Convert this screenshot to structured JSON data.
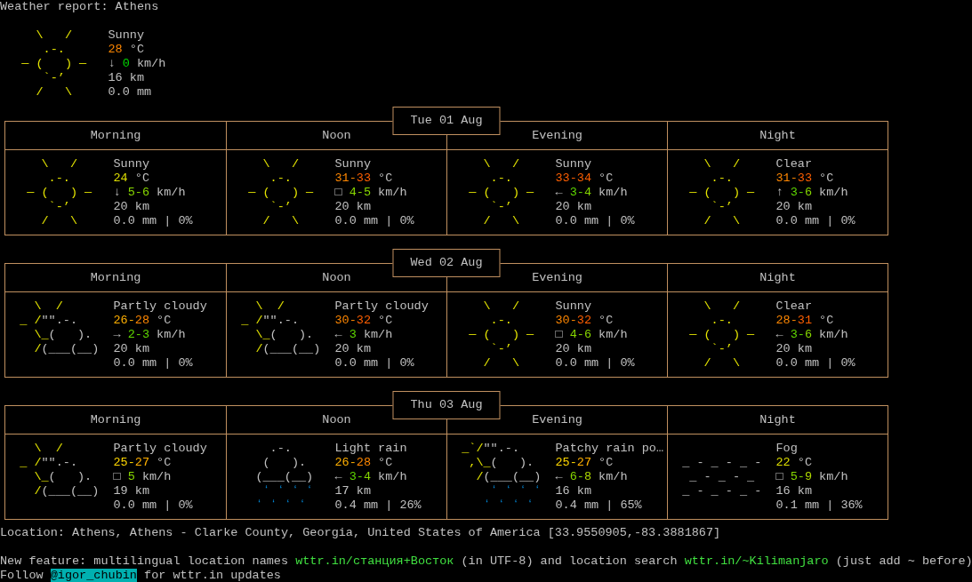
{
  "title": "Weather report: Athens",
  "current": {
    "art": [
      [
        {
          "text": "    \\   /    ",
          "kind": "sun"
        }
      ],
      [
        {
          "text": "     .-.     ",
          "kind": "sun"
        }
      ],
      [
        {
          "text": "  ― (   ) ―  ",
          "kind": "sun"
        }
      ],
      [
        {
          "text": "     `-’     ",
          "kind": "sun"
        }
      ],
      [
        {
          "text": "    /   \\    ",
          "kind": "sun"
        }
      ]
    ],
    "condition": "Sunny",
    "temp": [
      {
        "text": "28",
        "color": "#ff8700"
      }
    ],
    "temp_unit": "°C",
    "wind_dir": "↓",
    "wind": [
      {
        "text": "0",
        "color": "#00d700"
      }
    ],
    "wind_unit": "km/h",
    "visibility": "16 km",
    "precip": "0.0 mm"
  },
  "days": [
    {
      "date": "Tue 01 Aug",
      "periods": [
        {
          "label": "Morning",
          "kind": "sunny",
          "art": [
            [
              {
                "text": "    \\   /    ",
                "kind": "sun"
              }
            ],
            [
              {
                "text": "     .-.     ",
                "kind": "sun"
              }
            ],
            [
              {
                "text": "  ― (   ) ―  ",
                "kind": "sun"
              }
            ],
            [
              {
                "text": "     `-’     ",
                "kind": "sun"
              }
            ],
            [
              {
                "text": "    /   \\    ",
                "kind": "sun"
              }
            ]
          ],
          "condition": "Sunny",
          "temp": [
            {
              "text": "24",
              "color": "#dfdf00"
            }
          ],
          "temp_unit": "°C",
          "wind_dir": "↓",
          "wind": [
            {
              "text": "5-",
              "color": "#87d700"
            },
            {
              "text": "6",
              "color": "#87d700"
            }
          ],
          "wind_unit": "km/h",
          "visibility": "20 km",
          "precip": "0.0 mm | 0%"
        },
        {
          "label": "Noon",
          "kind": "sunny",
          "art": [
            [
              {
                "text": "    \\   /    ",
                "kind": "sun"
              }
            ],
            [
              {
                "text": "     .-.     ",
                "kind": "sun"
              }
            ],
            [
              {
                "text": "  ― (   ) ―  ",
                "kind": "sun"
              }
            ],
            [
              {
                "text": "     `-’     ",
                "kind": "sun"
              }
            ],
            [
              {
                "text": "    /   \\    ",
                "kind": "sun"
              }
            ]
          ],
          "condition": "Sunny",
          "temp": [
            {
              "text": "31-",
              "color": "#ff8700"
            },
            {
              "text": "33",
              "color": "#ff5f00"
            }
          ],
          "temp_unit": "°C",
          "wind_dir": "□",
          "wind": [
            {
              "text": "4-",
              "color": "#87d700"
            },
            {
              "text": "5",
              "color": "#87d700"
            }
          ],
          "wind_unit": "km/h",
          "visibility": "20 km",
          "precip": "0.0 mm | 0%"
        },
        {
          "label": "Evening",
          "kind": "sunny",
          "art": [
            [
              {
                "text": "    \\   /    ",
                "kind": "sun"
              }
            ],
            [
              {
                "text": "     .-.     ",
                "kind": "sun"
              }
            ],
            [
              {
                "text": "  ― (   ) ―  ",
                "kind": "sun"
              }
            ],
            [
              {
                "text": "     `-’     ",
                "kind": "sun"
              }
            ],
            [
              {
                "text": "    /   \\    ",
                "kind": "sun"
              }
            ]
          ],
          "condition": "Sunny",
          "temp": [
            {
              "text": "33-",
              "color": "#ff5f00"
            },
            {
              "text": "34",
              "color": "#ff5f00"
            }
          ],
          "temp_unit": "°C",
          "wind_dir": "←",
          "wind": [
            {
              "text": "3-",
              "color": "#5fd700"
            },
            {
              "text": "4",
              "color": "#87d700"
            }
          ],
          "wind_unit": "km/h",
          "visibility": "20 km",
          "precip": "0.0 mm | 0%"
        },
        {
          "label": "Night",
          "kind": "sunny",
          "art": [
            [
              {
                "text": "    \\   /    ",
                "kind": "sun"
              }
            ],
            [
              {
                "text": "     .-.     ",
                "kind": "sun"
              }
            ],
            [
              {
                "text": "  ― (   ) ―  ",
                "kind": "sun"
              }
            ],
            [
              {
                "text": "     `-’     ",
                "kind": "sun"
              }
            ],
            [
              {
                "text": "    /   \\    ",
                "kind": "sun"
              }
            ]
          ],
          "condition": "Clear",
          "temp": [
            {
              "text": "31-",
              "color": "#ff8700"
            },
            {
              "text": "33",
              "color": "#ff5f00"
            }
          ],
          "temp_unit": "°C",
          "wind_dir": "↑",
          "wind": [
            {
              "text": "3-",
              "color": "#5fd700"
            },
            {
              "text": "6",
              "color": "#87d700"
            }
          ],
          "wind_unit": "km/h",
          "visibility": "20 km",
          "precip": "0.0 mm | 0%"
        }
      ]
    },
    {
      "date": "Wed 02 Aug",
      "periods": [
        {
          "label": "Morning",
          "kind": "partly_cloudy",
          "art": [
            [
              {
                "text": "   \\  /      ",
                "kind": "sun"
              }
            ],
            [
              {
                "text": " _ /",
                "kind": "sun"
              },
              {
                "text": "\"\".-.    ",
                "kind": "cloud"
              }
            ],
            [
              {
                "text": "   \\_",
                "kind": "sun"
              },
              {
                "text": "(   ).  ",
                "kind": "cloud"
              }
            ],
            [
              {
                "text": "   /",
                "kind": "sun"
              },
              {
                "text": "(___(__) ",
                "kind": "cloud"
              }
            ]
          ],
          "condition": "Partly cloudy",
          "temp": [
            {
              "text": "26-",
              "color": "#ffaf00"
            },
            {
              "text": "28",
              "color": "#ff8700"
            }
          ],
          "temp_unit": "°C",
          "wind_dir": "→",
          "wind": [
            {
              "text": "2-",
              "color": "#5fd700"
            },
            {
              "text": "3",
              "color": "#5fd700"
            }
          ],
          "wind_unit": "km/h",
          "visibility": "20 km",
          "precip": "0.0 mm | 0%"
        },
        {
          "label": "Noon",
          "kind": "partly_cloudy",
          "art": [
            [
              {
                "text": "   \\  /      ",
                "kind": "sun"
              }
            ],
            [
              {
                "text": " _ /",
                "kind": "sun"
              },
              {
                "text": "\"\".-.    ",
                "kind": "cloud"
              }
            ],
            [
              {
                "text": "   \\_",
                "kind": "sun"
              },
              {
                "text": "(   ).  ",
                "kind": "cloud"
              }
            ],
            [
              {
                "text": "   /",
                "kind": "sun"
              },
              {
                "text": "(___(__) ",
                "kind": "cloud"
              }
            ]
          ],
          "condition": "Partly cloudy",
          "temp": [
            {
              "text": "30-",
              "color": "#ff8700"
            },
            {
              "text": "32",
              "color": "#ff5f00"
            }
          ],
          "temp_unit": "°C",
          "wind_dir": "←",
          "wind": [
            {
              "text": "3",
              "color": "#5fd700"
            }
          ],
          "wind_unit": "km/h",
          "visibility": "20 km",
          "precip": "0.0 mm | 0%"
        },
        {
          "label": "Evening",
          "kind": "sunny",
          "art": [
            [
              {
                "text": "    \\   /    ",
                "kind": "sun"
              }
            ],
            [
              {
                "text": "     .-.     ",
                "kind": "sun"
              }
            ],
            [
              {
                "text": "  ― (   ) ―  ",
                "kind": "sun"
              }
            ],
            [
              {
                "text": "     `-’     ",
                "kind": "sun"
              }
            ],
            [
              {
                "text": "    /   \\    ",
                "kind": "sun"
              }
            ]
          ],
          "condition": "Sunny",
          "temp": [
            {
              "text": "30-",
              "color": "#ff8700"
            },
            {
              "text": "32",
              "color": "#ff5f00"
            }
          ],
          "temp_unit": "°C",
          "wind_dir": "□",
          "wind": [
            {
              "text": "4-",
              "color": "#87d700"
            },
            {
              "text": "6",
              "color": "#87d700"
            }
          ],
          "wind_unit": "km/h",
          "visibility": "20 km",
          "precip": "0.0 mm | 0%"
        },
        {
          "label": "Night",
          "kind": "sunny",
          "art": [
            [
              {
                "text": "    \\   /    ",
                "kind": "sun"
              }
            ],
            [
              {
                "text": "     .-.     ",
                "kind": "sun"
              }
            ],
            [
              {
                "text": "  ― (   ) ―  ",
                "kind": "sun"
              }
            ],
            [
              {
                "text": "     `-’     ",
                "kind": "sun"
              }
            ],
            [
              {
                "text": "    /   \\    ",
                "kind": "sun"
              }
            ]
          ],
          "condition": "Clear",
          "temp": [
            {
              "text": "28-",
              "color": "#ff8700"
            },
            {
              "text": "31",
              "color": "#ff5f00"
            }
          ],
          "temp_unit": "°C",
          "wind_dir": "←",
          "wind": [
            {
              "text": "3-",
              "color": "#5fd700"
            },
            {
              "text": "6",
              "color": "#87d700"
            }
          ],
          "wind_unit": "km/h",
          "visibility": "20 km",
          "precip": "0.0 mm | 0%"
        }
      ]
    },
    {
      "date": "Thu 03 Aug",
      "periods": [
        {
          "label": "Morning",
          "kind": "partly_cloudy",
          "art": [
            [
              {
                "text": "   \\  /      ",
                "kind": "sun"
              }
            ],
            [
              {
                "text": " _ /",
                "kind": "sun"
              },
              {
                "text": "\"\".-.    ",
                "kind": "cloud"
              }
            ],
            [
              {
                "text": "   \\_",
                "kind": "sun"
              },
              {
                "text": "(   ).  ",
                "kind": "cloud"
              }
            ],
            [
              {
                "text": "   /",
                "kind": "sun"
              },
              {
                "text": "(___(__) ",
                "kind": "cloud"
              }
            ]
          ],
          "condition": "Partly cloudy",
          "temp": [
            {
              "text": "25-",
              "color": "#ffd700"
            },
            {
              "text": "27",
              "color": "#ffaf00"
            }
          ],
          "temp_unit": "°C",
          "wind_dir": "□",
          "wind": [
            {
              "text": "5",
              "color": "#87d700"
            }
          ],
          "wind_unit": "km/h",
          "visibility": "19 km",
          "precip": "0.0 mm | 0%"
        },
        {
          "label": "Noon",
          "kind": "rain",
          "art": [
            [
              {
                "text": "     .-.     ",
                "kind": "cloud"
              }
            ],
            [
              {
                "text": "    (   ).   ",
                "kind": "cloud"
              }
            ],
            [
              {
                "text": "   (___(__)  ",
                "kind": "cloud"
              }
            ],
            [
              {
                "text": "    ʻ ʻ ʻ ʻ  ",
                "kind": "rain"
              }
            ],
            [
              {
                "text": "   ʻ ʻ ʻ ʻ   ",
                "kind": "rain"
              }
            ]
          ],
          "condition": "Light rain",
          "temp": [
            {
              "text": "26-",
              "color": "#ffaf00"
            },
            {
              "text": "28",
              "color": "#ff8700"
            }
          ],
          "temp_unit": "°C",
          "wind_dir": "←",
          "wind": [
            {
              "text": "3-",
              "color": "#5fd700"
            },
            {
              "text": "4",
              "color": "#87d700"
            }
          ],
          "wind_unit": "km/h",
          "visibility": "17 km",
          "precip": "0.4 mm | 26%"
        },
        {
          "label": "Evening",
          "kind": "rain",
          "art": [
            [
              {
                "text": " _`/",
                "kind": "sun"
              },
              {
                "text": "\"\".-.    ",
                "kind": "cloud"
              }
            ],
            [
              {
                "text": "  ,\\_",
                "kind": "sun"
              },
              {
                "text": "(   ).  ",
                "kind": "cloud"
              }
            ],
            [
              {
                "text": "   /",
                "kind": "sun"
              },
              {
                "text": "(___(__) ",
                "kind": "cloud"
              }
            ],
            [
              {
                "text": "     ʻ ʻ ʻ ʻ ",
                "kind": "rain"
              }
            ],
            [
              {
                "text": "    ʻ ʻ ʻ ʻ  ",
                "kind": "rain"
              }
            ]
          ],
          "condition": "Patchy rain po…",
          "temp": [
            {
              "text": "25-",
              "color": "#ffd700"
            },
            {
              "text": "27",
              "color": "#ffaf00"
            }
          ],
          "temp_unit": "°C",
          "wind_dir": "←",
          "wind": [
            {
              "text": "6-",
              "color": "#87d700"
            },
            {
              "text": "8",
              "color": "#afd700"
            }
          ],
          "wind_unit": "km/h",
          "visibility": "16 km",
          "precip": "0.4 mm | 65%"
        },
        {
          "label": "Night",
          "kind": "fog",
          "art": [
            [
              {
                "text": " _ - _ - _ - ",
                "kind": "fog"
              }
            ],
            [
              {
                "text": "  _ - _ - _  ",
                "kind": "fog"
              }
            ],
            [
              {
                "text": " _ - _ - _ - ",
                "kind": "fog"
              }
            ]
          ],
          "condition": "Fog",
          "temp": [
            {
              "text": "22",
              "color": "#dfdf00"
            }
          ],
          "temp_unit": "°C",
          "wind_dir": "□",
          "wind": [
            {
              "text": "5-",
              "color": "#87d700"
            },
            {
              "text": "9",
              "color": "#afd700"
            }
          ],
          "wind_unit": "km/h",
          "visibility": "16 km",
          "precip": "0.1 mm | 36%"
        }
      ]
    }
  ],
  "location": "Location: Athens, Athens - Clarke County, Georgia, United States of America [33.9550905,-83.3881867]",
  "notice": {
    "before": "New feature: multilingual location names",
    "link_1": "wttr.in/станция+Восток",
    "middle": "(in UTF-8) and location search",
    "link_2": "wttr.in/~Kilimanjaro",
    "after": "(just add ~ before)"
  },
  "follow": {
    "before": "Follow",
    "handle": "@igor_chubin",
    "after": "for wttr.in updates"
  }
}
